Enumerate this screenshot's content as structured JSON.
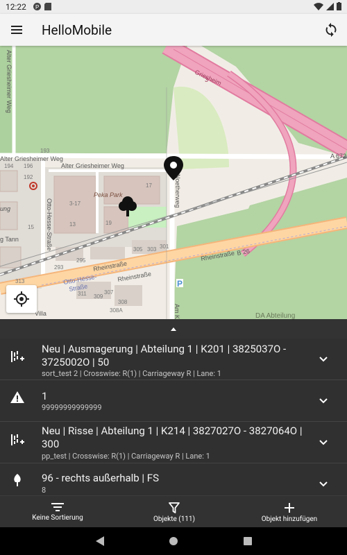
{
  "status_bar": {
    "time": "12:22"
  },
  "app_bar": {
    "title": "HelloMobile",
    "menu_icon": "menu-icon",
    "sync_icon": "sync-icon"
  },
  "map": {
    "labels": {
      "alter_griesheimer_weg_vertical": "Alter Griesheimer Weg",
      "alter_griesheimer_weg_left": "Alter Griesheimer Weg",
      "alter_griesheimer_weg": "Alter Griesheimer Weg",
      "griesheim": "Griesheim",
      "griesheim_num": "3",
      "a672": "A 672",
      "peka_park": "Peka Park",
      "otto_hesse_strasse": "Otto-Hesse-Straße",
      "noetherweg": "Noetherweg",
      "rheinstrasse_1": "Rheinstraße",
      "rheinstrasse_2": "Rheinstraße",
      "rheinstrasse_3": "Rheinstraße",
      "b26": "B 26",
      "da_abteilung": "DA Abteilung",
      "am_k": "Am K",
      "tann": "g Tann",
      "ung": "ung",
      "villa": "Villa",
      "otto_hesse_2": "Otto-Hesse-",
      "strasse_2": "Straße",
      "house_numbers": [
        "193",
        "194",
        "196",
        "192",
        "17",
        "3-17",
        "19",
        "13",
        "15",
        "305",
        "303",
        "301",
        "295",
        "293",
        "313",
        "311",
        "309",
        "307",
        "308",
        "308A",
        "193"
      ]
    }
  },
  "list": {
    "items": [
      {
        "icon": "crack-add-icon",
        "title": "Neu | Ausmagerung | Abteilung 1 | K201 | 3825037O - 3725002O | 50",
        "subtitle": "sort_test 2 | Crosswise: R(1) | Carriageway  R | Lane: 1"
      },
      {
        "icon": "warning-icon",
        "title": "1",
        "subtitle": "99999999999999"
      },
      {
        "icon": "crack-add-icon",
        "title": "Neu | Risse | Abteilung 1 | K214 | 3827027O - 3827064O | 300",
        "subtitle": "pp_test | Crosswise: R(1) | Carriageway  R | Lane: 1"
      },
      {
        "icon": "tree-icon",
        "title": "96 - rechts außerhalb | FS",
        "subtitle": "8"
      }
    ]
  },
  "bottom_nav": {
    "sort_label": "Keine Sortierung",
    "filter_label": "Objekte (111)",
    "add_label": "Objekt hinzufügen"
  }
}
